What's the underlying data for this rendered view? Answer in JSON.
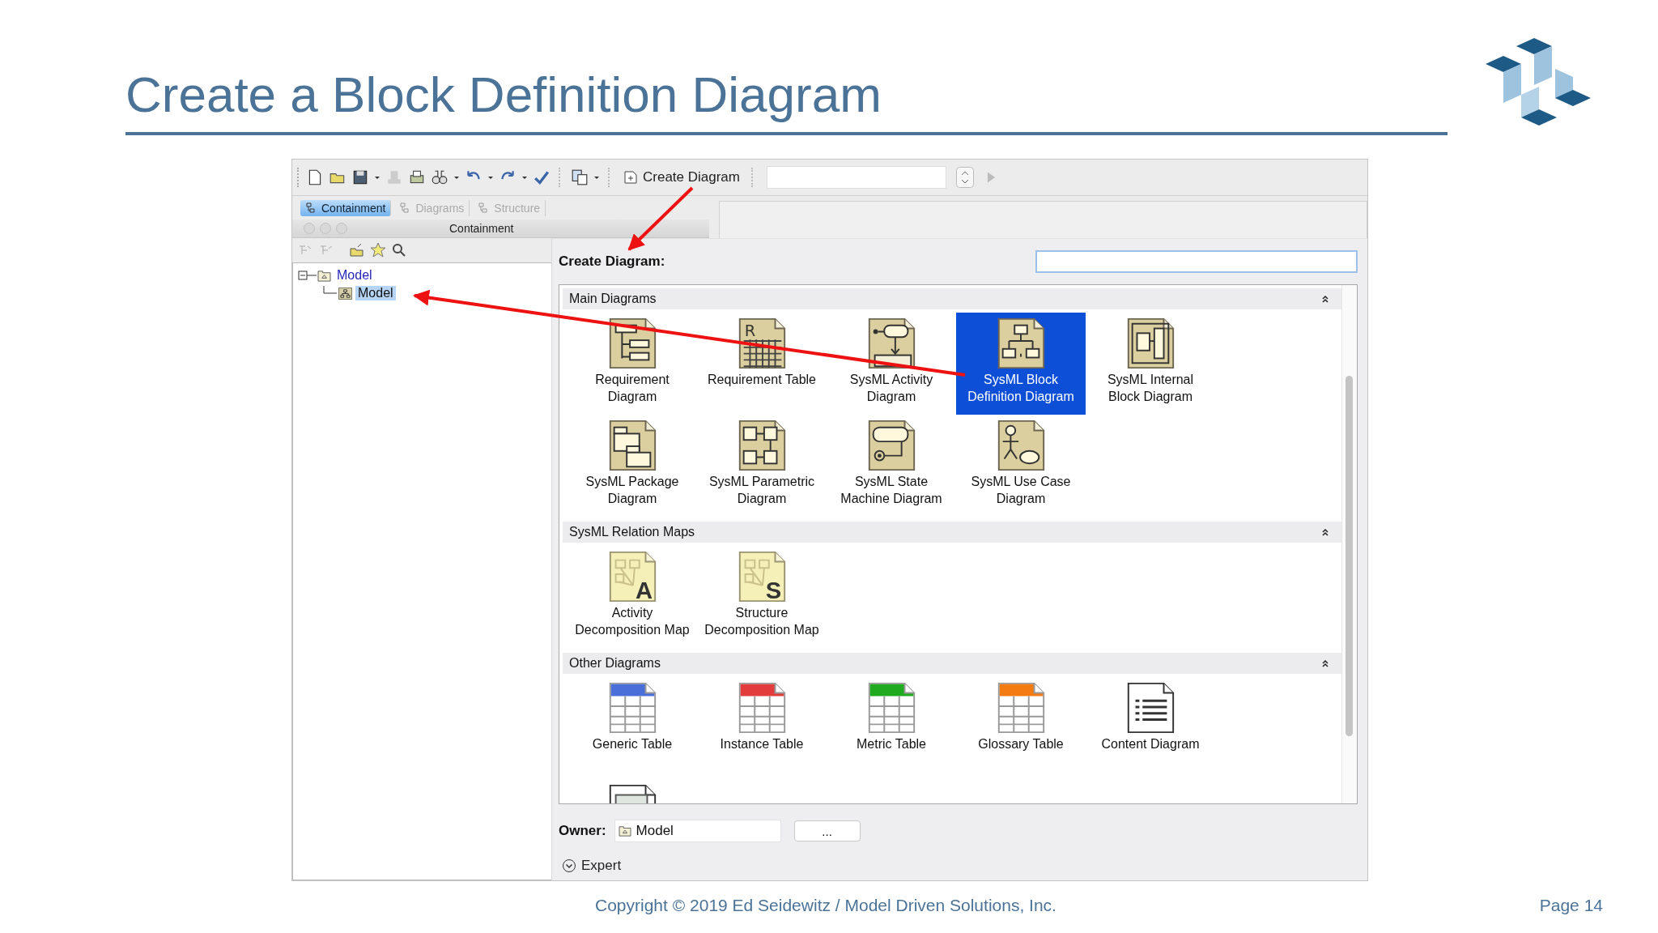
{
  "slide": {
    "title": "Create a Block Definition Diagram",
    "footer": "Copyright © 2019 Ed Seidewitz / Model Driven Solutions, Inc.",
    "page": "Page 14"
  },
  "toolbar": {
    "create_button": "Create Diagram"
  },
  "browser_tabs": [
    {
      "label": "Containment",
      "selected": true
    },
    {
      "label": "Diagrams",
      "selected": false
    },
    {
      "label": "Structure",
      "selected": false
    }
  ],
  "panel_title": "Containment",
  "tree": [
    {
      "label": "Model",
      "kind": "package",
      "expanded": true,
      "selected": false,
      "children": [
        {
          "label": "Model",
          "kind": "diagram",
          "selected": true
        }
      ]
    }
  ],
  "dialog": {
    "title": "Create Diagram:",
    "sections": [
      {
        "title": "Main Diagrams",
        "expanded": true,
        "items": [
          {
            "label": "Requirement Diagram",
            "kind": "requirement",
            "selected": false
          },
          {
            "label": "Requirement Table",
            "kind": "req-table",
            "letter": "R",
            "selected": false
          },
          {
            "label": "SysML Activity Diagram",
            "kind": "activity",
            "selected": false
          },
          {
            "label": "SysML Block Definition Diagram",
            "kind": "bdd",
            "selected": true
          },
          {
            "label": "SysML Internal Block Diagram",
            "kind": "ibd",
            "selected": false
          },
          {
            "label": "SysML Package Diagram",
            "kind": "package",
            "selected": false
          },
          {
            "label": "SysML Parametric Diagram",
            "kind": "parametric",
            "selected": false
          },
          {
            "label": "SysML State Machine Diagram",
            "kind": "state",
            "selected": false
          },
          {
            "label": "SysML Use Case Diagram",
            "kind": "usecase",
            "selected": false
          }
        ]
      },
      {
        "title": "SysML Relation Maps",
        "expanded": true,
        "items": [
          {
            "label": "Activity Decomposition Map",
            "kind": "map",
            "letter": "A",
            "selected": false
          },
          {
            "label": "Structure Decomposition Map",
            "kind": "map",
            "letter": "S",
            "selected": false
          }
        ]
      },
      {
        "title": "Other Diagrams",
        "expanded": true,
        "items": [
          {
            "label": "Generic Table",
            "kind": "table",
            "color": "#4a6fd8",
            "selected": false
          },
          {
            "label": "Instance Table",
            "kind": "table",
            "color": "#e23c3c",
            "selected": false
          },
          {
            "label": "Metric Table",
            "kind": "table",
            "color": "#1faa1f",
            "selected": false
          },
          {
            "label": "Glossary Table",
            "kind": "table",
            "color": "#f47a12",
            "selected": false
          },
          {
            "label": "Content Diagram",
            "kind": "content",
            "selected": false
          },
          {
            "kind": "frame",
            "selected": false
          }
        ]
      }
    ],
    "owner_label": "Owner:",
    "owner_value": "Model",
    "browse_button": "...",
    "expert_label": "Expert"
  }
}
